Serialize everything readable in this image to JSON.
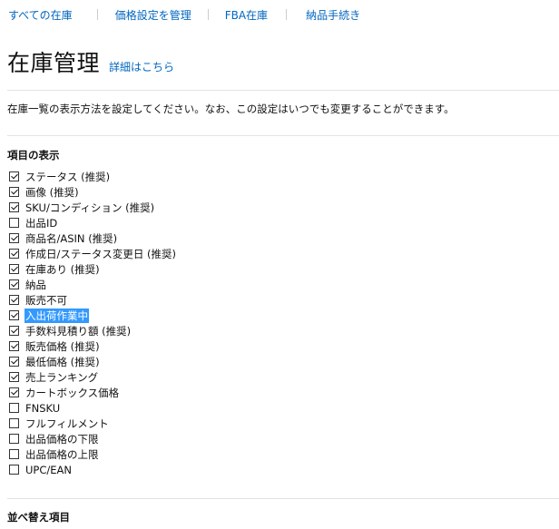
{
  "nav": {
    "items": [
      {
        "label": "すべての在庫"
      },
      {
        "label": "価格設定を管理"
      },
      {
        "label": "FBA在庫"
      },
      {
        "label": "納品手続き"
      }
    ]
  },
  "header": {
    "title": "在庫管理",
    "details_link": "詳細はこちら"
  },
  "description": "在庫一覧の表示方法を設定してください。なお、この設定はいつでも変更することができます。",
  "columns_section": {
    "title": "項目の表示",
    "options": [
      {
        "label": "ステータス (推奨)",
        "checked": true
      },
      {
        "label": "画像 (推奨)",
        "checked": true
      },
      {
        "label": "SKU/コンディション (推奨)",
        "checked": true
      },
      {
        "label": "出品ID",
        "checked": false
      },
      {
        "label": "商品名/ASIN (推奨)",
        "checked": true
      },
      {
        "label": "作成日/ステータス変更日 (推奨)",
        "checked": true
      },
      {
        "label": "在庫あり (推奨)",
        "checked": true
      },
      {
        "label": "納品",
        "checked": true
      },
      {
        "label": "販売不可",
        "checked": true
      },
      {
        "label": "入出荷作業中",
        "checked": true,
        "selected": true
      },
      {
        "label": "手数料見積り額 (推奨)",
        "checked": true
      },
      {
        "label": "販売価格 (推奨)",
        "checked": true
      },
      {
        "label": "最低価格 (推奨)",
        "checked": true
      },
      {
        "label": "売上ランキング",
        "checked": true
      },
      {
        "label": "カートボックス価格",
        "checked": true
      },
      {
        "label": "FNSKU",
        "checked": false
      },
      {
        "label": "フルフィルメント",
        "checked": false
      },
      {
        "label": "出品価格の下限",
        "checked": false
      },
      {
        "label": "出品価格の上限",
        "checked": false
      },
      {
        "label": "UPC/EAN",
        "checked": false
      }
    ]
  },
  "sort_section": {
    "title": "並べ替え項目"
  }
}
